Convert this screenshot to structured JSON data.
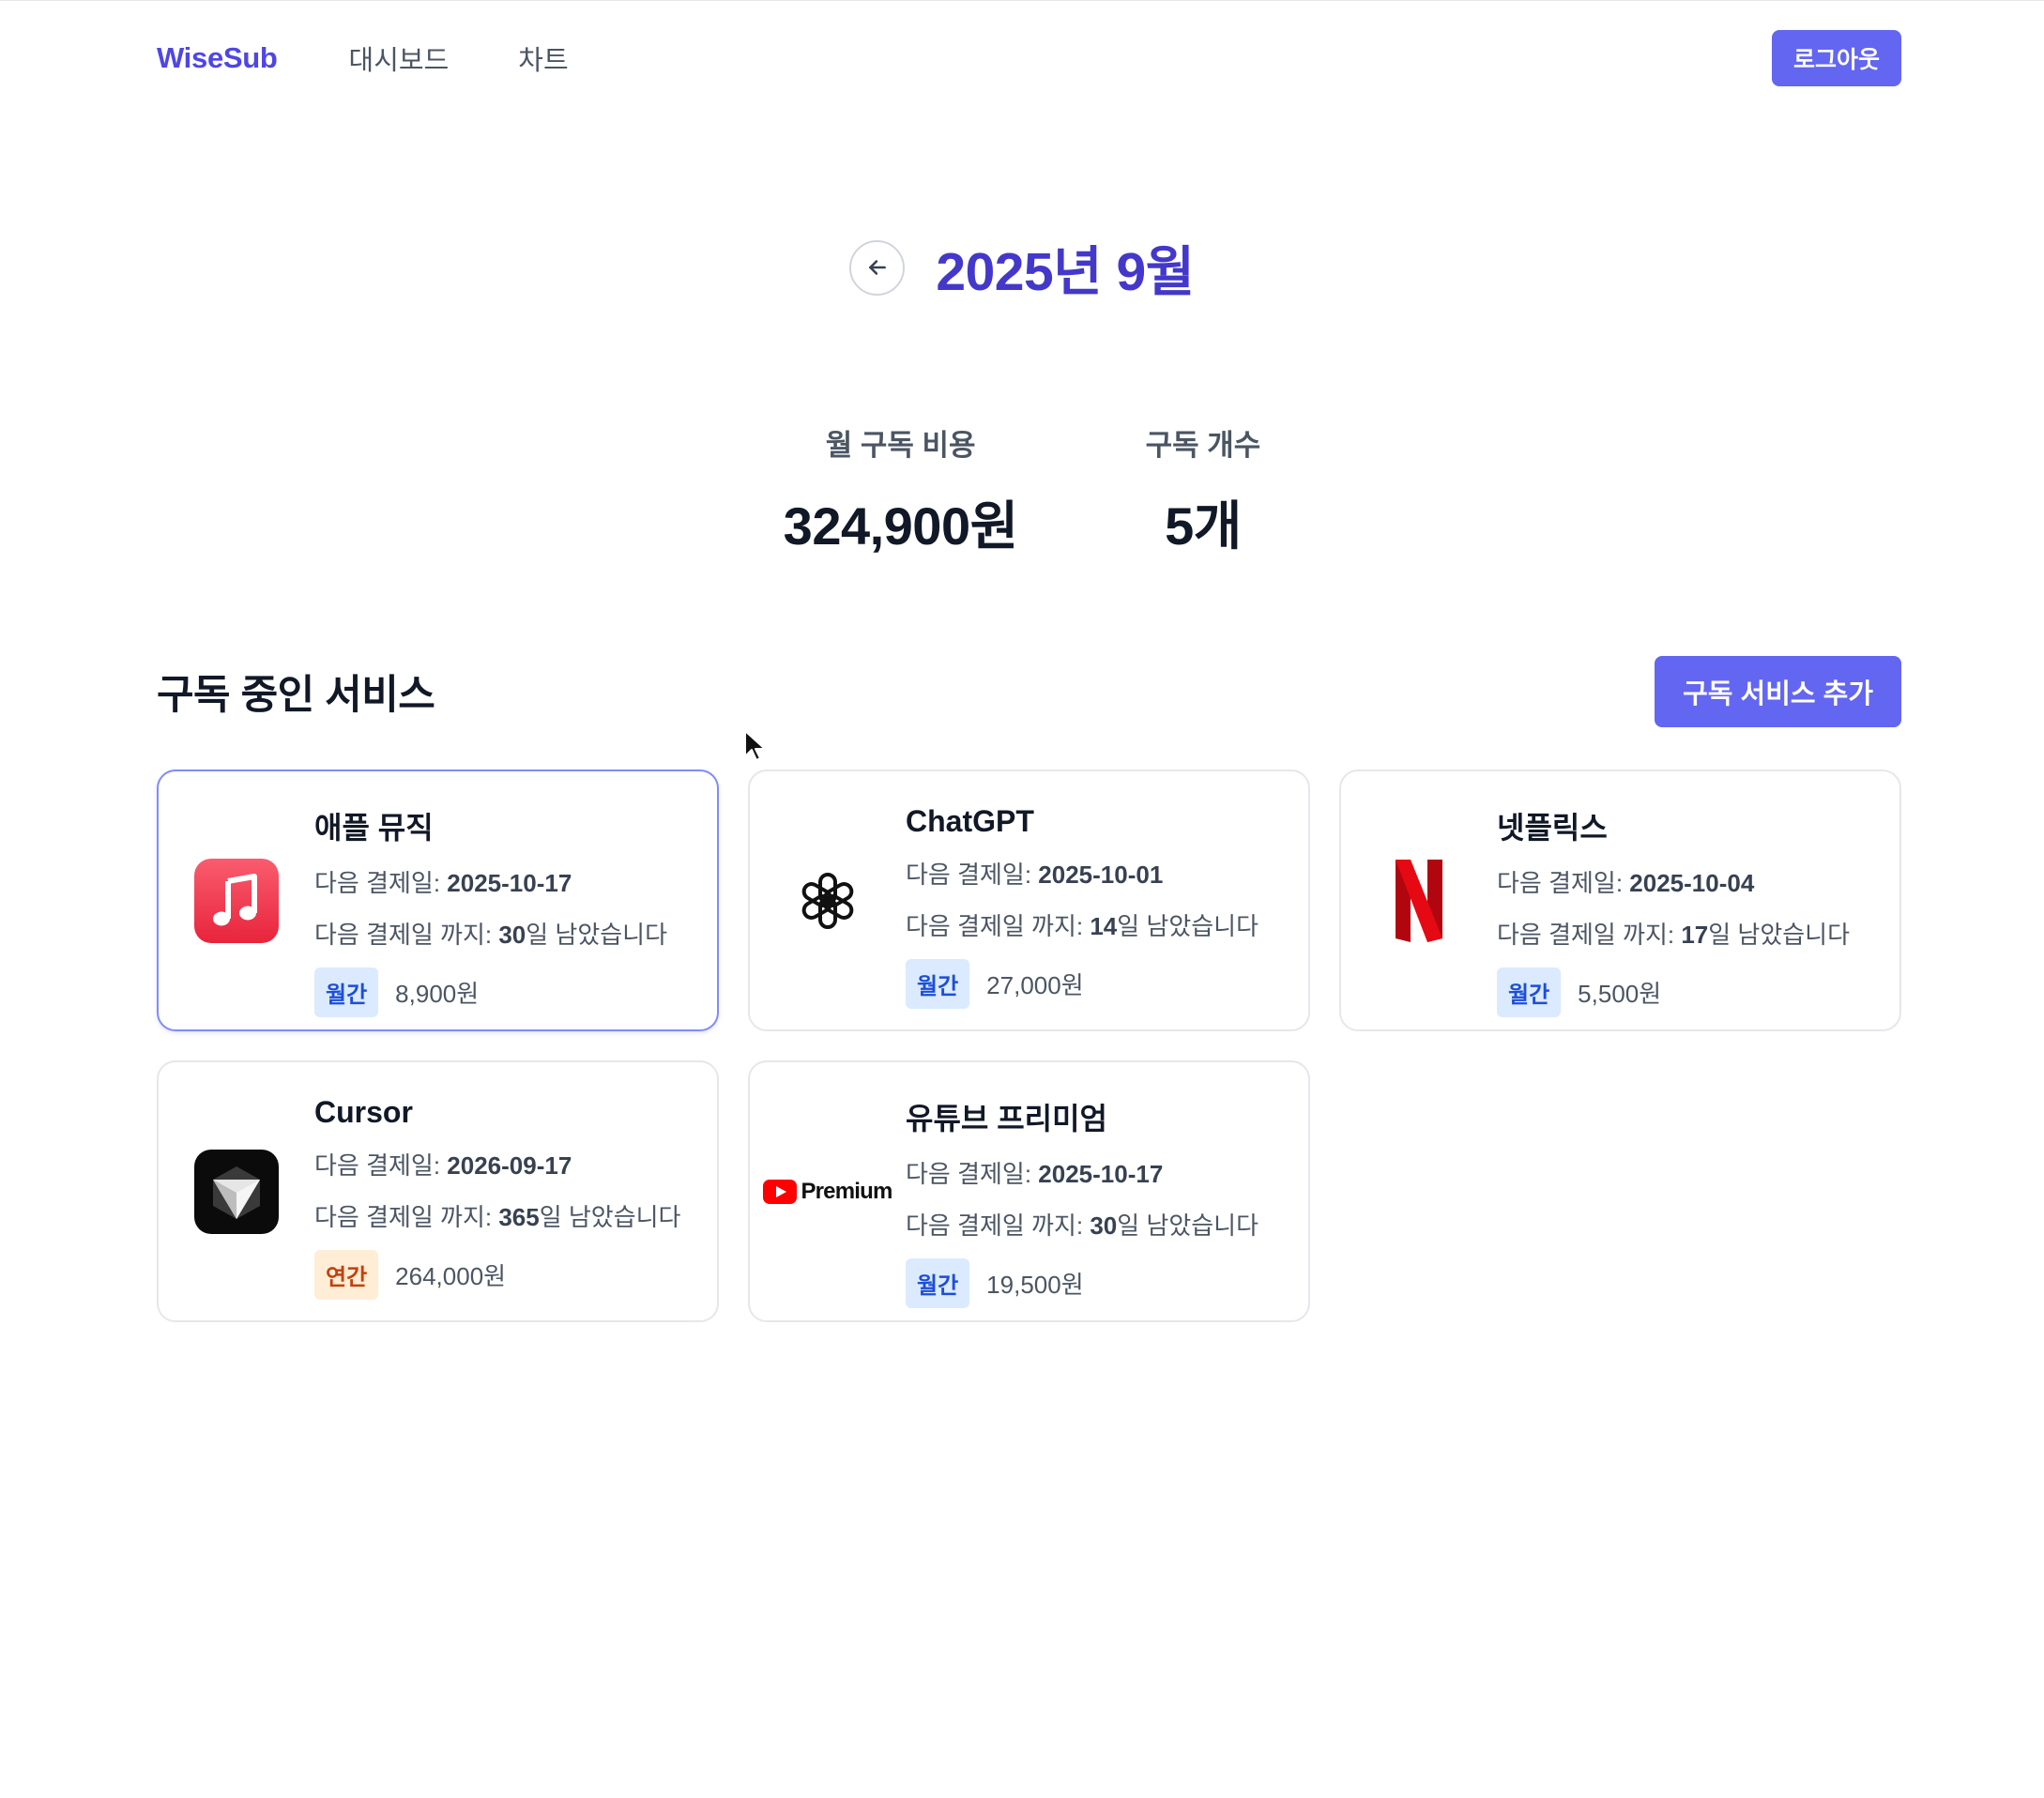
{
  "nav": {
    "logo": "WiseSub",
    "links": [
      "대시보드",
      "차트"
    ],
    "logout_label": "로그아웃"
  },
  "month": {
    "title": "2025년 9월"
  },
  "stats": {
    "cost_label": "월 구독 비용",
    "cost_value": "324,900원",
    "count_label": "구독 개수",
    "count_value": "5개"
  },
  "section": {
    "title": "구독 중인 서비스",
    "add_label": "구독 서비스 추가"
  },
  "labels": {
    "next_date": "다음 결제일: ",
    "days_prefix": "다음 결제일 까지: ",
    "days_suffix": "일 남았습니다"
  },
  "subscriptions": [
    {
      "name": "애플 뮤직",
      "icon": "apple-music-icon",
      "next_date": "2025-10-17",
      "days_left": "30",
      "cycle": "월간",
      "price": "8,900원"
    },
    {
      "name": "ChatGPT",
      "icon": "chatgpt-icon",
      "next_date": "2025-10-01",
      "days_left": "14",
      "cycle": "월간",
      "price": "27,000원"
    },
    {
      "name": "넷플릭스",
      "icon": "netflix-icon",
      "next_date": "2025-10-04",
      "days_left": "17",
      "cycle": "월간",
      "price": "5,500원"
    },
    {
      "name": "Cursor",
      "icon": "cursor-app-icon",
      "next_date": "2026-09-17",
      "days_left": "365",
      "cycle": "연간",
      "price": "264,000원"
    },
    {
      "name": "유튜브 프리미엄",
      "icon": "youtube-premium-icon",
      "logo_text": "Premium",
      "next_date": "2025-10-17",
      "days_left": "30",
      "cycle": "월간",
      "price": "19,500원"
    }
  ],
  "colors": {
    "accent": "#6366f1",
    "title": "#4338ca",
    "monthly_badge": "#dbeafe",
    "yearly_badge": "#ffedd5"
  }
}
